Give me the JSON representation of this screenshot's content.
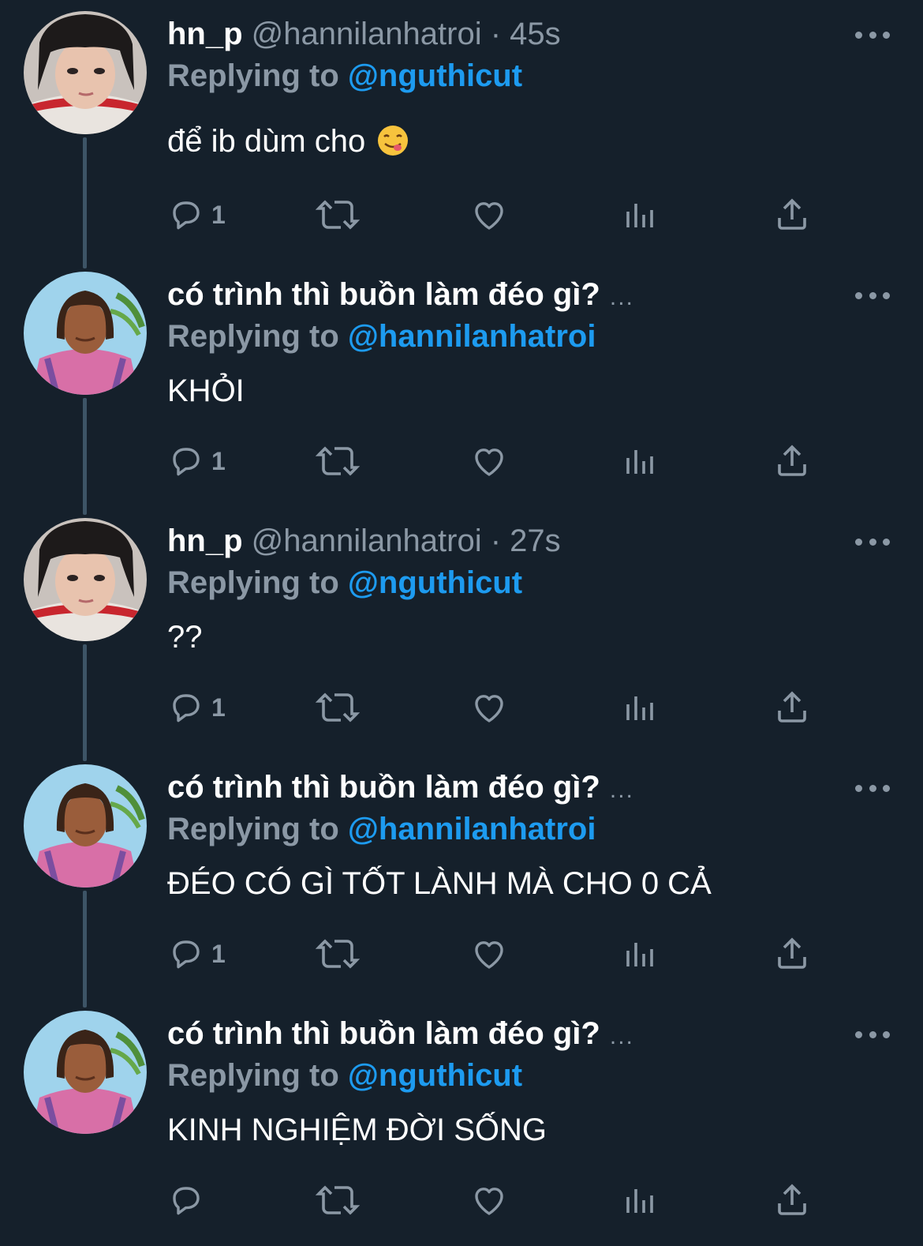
{
  "tweets": [
    {
      "display_name": "hn_p",
      "handle": "@hannilanhatroi",
      "dot": "·",
      "timestamp": "45s",
      "name_ellipsis": "",
      "replying_prefix": "Replying to ",
      "replying_to": "@nguthicut",
      "text": "để ib dùm cho",
      "emoji": "😋",
      "reply_count": "1",
      "avatar": "girl-avatar"
    },
    {
      "display_name": "có trình thì buồn làm đéo gì?",
      "handle": "",
      "dot": "",
      "timestamp": "",
      "name_ellipsis": "...",
      "replying_prefix": "Replying to ",
      "replying_to": "@hannilanhatroi",
      "text": "KHỎI",
      "emoji": "",
      "reply_count": "1",
      "avatar": "man-wig-avatar"
    },
    {
      "display_name": "hn_p",
      "handle": "@hannilanhatroi",
      "dot": "·",
      "timestamp": "27s",
      "name_ellipsis": "",
      "replying_prefix": "Replying to ",
      "replying_to": "@nguthicut",
      "text": "??",
      "emoji": "",
      "reply_count": "1",
      "avatar": "girl-avatar"
    },
    {
      "display_name": "có trình thì buồn làm đéo gì?",
      "handle": "",
      "dot": "",
      "timestamp": "",
      "name_ellipsis": "...",
      "replying_prefix": "Replying to ",
      "replying_to": "@hannilanhatroi",
      "text": "ĐÉO CÓ GÌ TỐT LÀNH MÀ CHO 0 CẢ",
      "emoji": "",
      "reply_count": "1",
      "avatar": "man-wig-avatar"
    },
    {
      "display_name": "có trình thì buồn làm đéo gì?",
      "handle": "",
      "dot": "",
      "timestamp": "",
      "name_ellipsis": "...",
      "replying_prefix": "Replying to ",
      "replying_to": "@nguthicut",
      "text": "KINH NGHIỆM ĐỜI SỐNG",
      "emoji": "",
      "reply_count": "",
      "avatar": "man-wig-avatar"
    }
  ],
  "icons": {
    "reply": "reply-icon",
    "retweet": "retweet-icon",
    "like": "heart-icon",
    "analytics": "analytics-icon",
    "share": "share-icon",
    "more": "more-icon"
  },
  "colors": {
    "background": "#15202b",
    "secondary_text": "#8b98a5",
    "accent": "#1d9bf0",
    "thread_line": "#3d5466"
  }
}
